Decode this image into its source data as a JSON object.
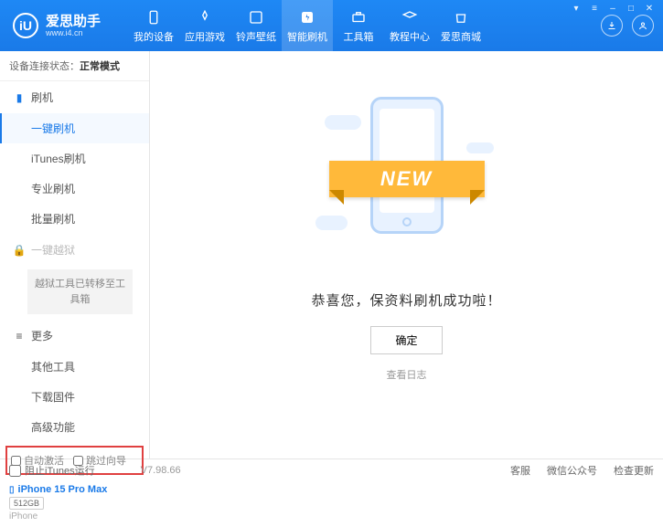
{
  "app": {
    "title": "爱思助手",
    "subtitle": "www.i4.cn",
    "logo_letter": "iU"
  },
  "nav": {
    "items": [
      {
        "label": "我的设备"
      },
      {
        "label": "应用游戏"
      },
      {
        "label": "铃声壁纸"
      },
      {
        "label": "智能刷机"
      },
      {
        "label": "工具箱"
      },
      {
        "label": "教程中心"
      },
      {
        "label": "爱思商城"
      }
    ]
  },
  "status": {
    "prefix": "设备连接状态：",
    "value": "正常模式"
  },
  "sidebar": {
    "flash_header": "刷机",
    "flash_items": [
      "一键刷机",
      "iTunes刷机",
      "专业刷机",
      "批量刷机"
    ],
    "jailbreak_header": "一键越狱",
    "migrate_text": "越狱工具已转移至工具箱",
    "more_header": "更多",
    "more_items": [
      "其他工具",
      "下载固件",
      "高级功能"
    ]
  },
  "options": {
    "auto_activate": "自动激活",
    "skip_guide": "跳过向导"
  },
  "device": {
    "name": "iPhone 15 Pro Max",
    "storage": "512GB",
    "type": "iPhone"
  },
  "main": {
    "new_badge": "NEW",
    "success": "恭喜您，保资料刷机成功啦！",
    "ok": "确定",
    "view_log": "查看日志"
  },
  "footer": {
    "block_itunes": "阻止iTunes运行",
    "version": "V7.98.66",
    "links": [
      "客服",
      "微信公众号",
      "检查更新"
    ]
  }
}
